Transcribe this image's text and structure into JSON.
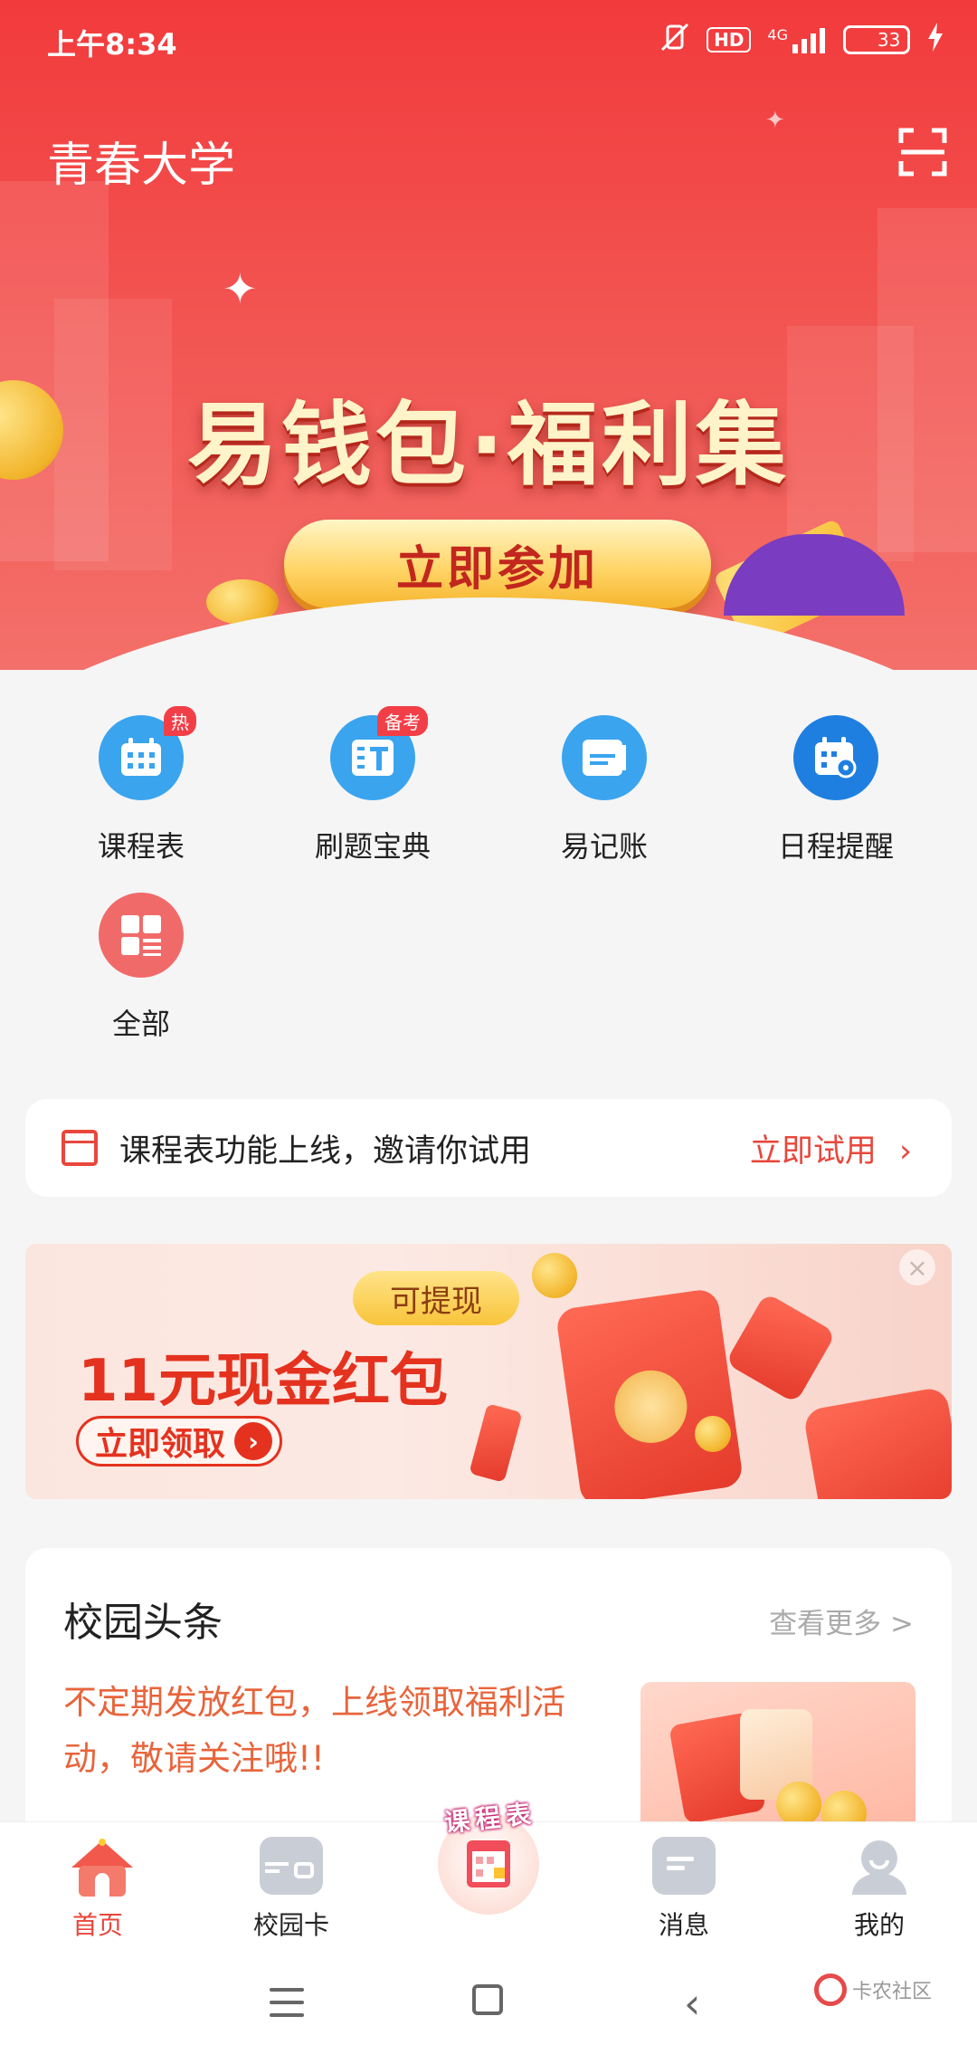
{
  "status_bar": {
    "time": "上午8:34",
    "hd_label": "HD",
    "network_label": "4G",
    "battery_level": "33"
  },
  "header": {
    "title": "青春大学"
  },
  "hero_banner": {
    "title": "易钱包·福利集",
    "button_label": "立即参加"
  },
  "quick_actions": [
    {
      "label": "课程表",
      "icon": "calendar-grid-icon",
      "badge": "热",
      "color": "#3aa4ef"
    },
    {
      "label": "刷题宝典",
      "icon": "quiz-book-icon",
      "badge": "备考",
      "color": "#3aa4ef"
    },
    {
      "label": "易记账",
      "icon": "ledger-icon",
      "badge": "",
      "color": "#3aa4ef"
    },
    {
      "label": "日程提醒",
      "icon": "schedule-reminder-icon",
      "badge": "",
      "color": "#1f7fe0"
    },
    {
      "label": "全部",
      "icon": "all-apps-icon",
      "badge": "",
      "color": "#f16a6a"
    }
  ],
  "notice": {
    "text": "课程表功能上线，邀请你试用",
    "action_label": "立即试用"
  },
  "promo_ad": {
    "tag": "可提现",
    "headline": "11元现金红包",
    "claim_label": "立即领取"
  },
  "news": {
    "section_title": "校园头条",
    "more_label": "查看更多 >",
    "item_text": "不定期发放红包，上线领取福利活动，敬请关注哦!!"
  },
  "tab_bar": {
    "tabs": [
      {
        "label": "首页",
        "icon": "home-icon",
        "active": true
      },
      {
        "label": "校园卡",
        "icon": "campus-card-icon",
        "active": false
      },
      {
        "label": "",
        "icon": "timetable-center-icon",
        "active": false
      },
      {
        "label": "消息",
        "icon": "message-icon",
        "active": false
      },
      {
        "label": "我的",
        "icon": "profile-icon",
        "active": false
      }
    ],
    "center_text": "课程表"
  },
  "watermark": {
    "text": "卡农社区"
  },
  "colors": {
    "brand_red": "#e8473c",
    "hero_red": "#f23a3c",
    "news_text": "#e8643b"
  }
}
